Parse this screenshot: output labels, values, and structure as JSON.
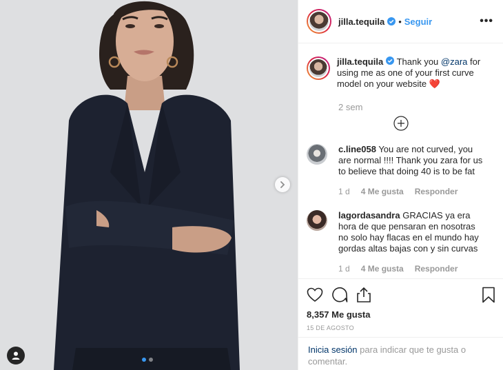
{
  "post": {
    "username": "jilla.tequila",
    "separator": "•",
    "follow_label": "Seguir",
    "more_label": "•••"
  },
  "caption": {
    "username": "jilla.tequila",
    "text_before": "Thank you ",
    "mention": "@zara",
    "text_after": " for using me as one of your first curve model on your website ❤️",
    "time": "2 sem"
  },
  "comments": [
    {
      "username": "c.line058",
      "text": "You are not curved, you are normal !!!! Thank you zara for us to believe that doing 40 is to be fat",
      "time": "1 d",
      "likes": "4 Me gusta",
      "reply": "Responder"
    },
    {
      "username": "lagordasandra",
      "text": "GRACIAS ya era hora de que pensaran en nosotras no solo hay flacas en el mundo hay gordas altas bajas con y sin curvas",
      "time": "1 d",
      "likes": "4 Me gusta",
      "reply": "Responder"
    }
  ],
  "stats": {
    "likes": "8,357 Me gusta",
    "date": "15 DE AGOSTO"
  },
  "login": {
    "link": "Inicia sesión",
    "text": " para indicar que te gusta o comentar."
  },
  "icons": {
    "like": "heart-icon",
    "comment": "comment-bubble-icon",
    "share": "share-icon",
    "save": "bookmark-icon",
    "load_more": "plus-circle-icon",
    "next": "chevron-right-icon",
    "tag": "user-tag-icon",
    "verified": "verified-badge-icon"
  },
  "colors": {
    "accent": "#3897f0",
    "mention": "#003569",
    "muted": "#999999"
  }
}
